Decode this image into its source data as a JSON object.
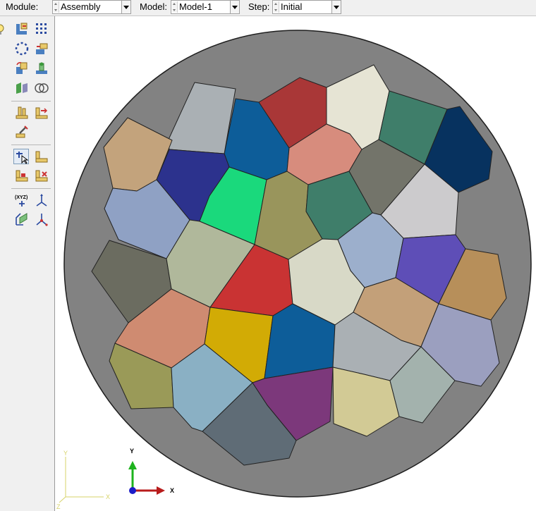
{
  "context_bar": {
    "module_label": "Module:",
    "module_value": "Assembly",
    "model_label": "Model:",
    "model_value": "Model-1",
    "step_label": "Step:",
    "step_value": "Initial"
  },
  "toolbox": {
    "tools": [
      "create-instance-icon",
      "linear-pattern-icon",
      "radial-pattern-icon",
      "translate-instance-icon",
      "rotate-instance-icon",
      "translate-to-icon",
      "merge-cut-icon",
      "merge-instances-icon",
      "parallel-face-icon",
      "edge-to-edge-icon",
      "coincident-point-icon",
      "query-icon",
      "constraint-icon",
      "datum-point-icon",
      "datum-csys-icon",
      "coordinate-xyz-icon",
      "datum-axis-icon",
      "datum-plane-icon",
      "csys-icon"
    ]
  },
  "viewport": {
    "triad": {
      "x": "X",
      "y": "Y",
      "z": "Z"
    },
    "background_color": "#ffffff",
    "disk_color": "#828282",
    "grain_colors": [
      "#a93737",
      "#0d5d99",
      "#e6e4d4",
      "#3f7e6a",
      "#07325f",
      "#aab0b4",
      "#c3a37c",
      "#2c328d",
      "#8fa1c4",
      "#1ad97c",
      "#99955c",
      "#d78c7d",
      "#73746a",
      "#cccbcd",
      "#9cafcc",
      "#5e4eb7",
      "#b78f5a",
      "#6b6c60",
      "#b0b89b",
      "#c93333",
      "#d8d9c7",
      "#c3a079",
      "#9b9fbf",
      "#cf8b71",
      "#d2ab05",
      "#7c387b",
      "#8ab0c4",
      "#9a9a58",
      "#5f6c76",
      "#d2ca95",
      "#a3b2ad"
    ]
  }
}
